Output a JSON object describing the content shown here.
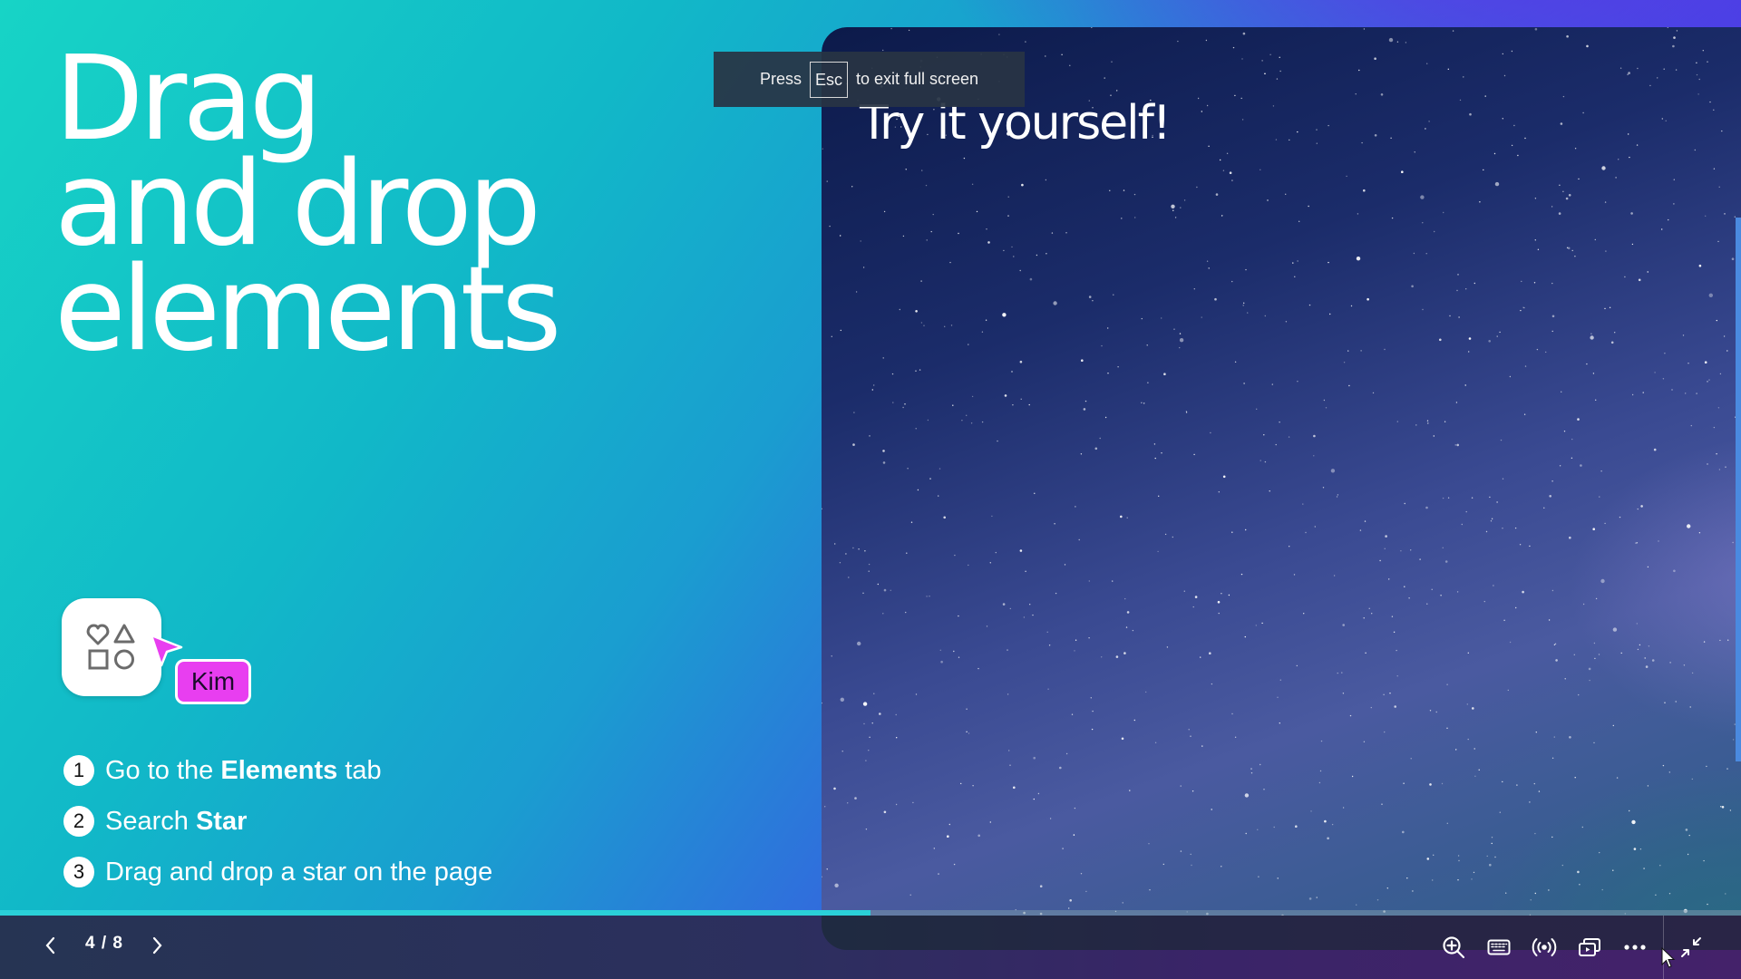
{
  "slide": {
    "title_lines": [
      "Drag",
      "and drop",
      "elements"
    ],
    "photo_title": "Try it yourself!",
    "collaborator_label": "Kim",
    "steps": [
      {
        "number": "1",
        "text_before": "Go to the ",
        "bold": "Elements",
        "text_after": " tab"
      },
      {
        "number": "2",
        "text_before": "Search ",
        "bold": "Star",
        "text_after": ""
      },
      {
        "number": "3",
        "text_before": "Drag and drop a star on the page",
        "bold": "",
        "text_after": ""
      }
    ],
    "icons": {
      "elements_tile": "shapes-icon",
      "collaborator_cursor": "pointer-cursor-icon"
    }
  },
  "toast": {
    "prefix": "Press",
    "key": "Esc",
    "suffix": "to exit full screen"
  },
  "presenter": {
    "page_current": 4,
    "page_total": 8,
    "page_label": "4 / 8",
    "progress_fraction": 0.5,
    "prev_icon": "chevron-left-icon",
    "next_icon": "chevron-right-icon",
    "controls": [
      {
        "name": "zoom-in",
        "icon": "zoom-in-icon"
      },
      {
        "name": "keyboard-shortcuts",
        "icon": "keyboard-icon"
      },
      {
        "name": "live-broadcast",
        "icon": "broadcast-icon"
      },
      {
        "name": "presenter-view",
        "icon": "presenter-view-icon"
      },
      {
        "name": "more-options",
        "icon": "more-horizontal-icon"
      },
      {
        "name": "exit-fullscreen",
        "icon": "minimize-icon"
      }
    ]
  },
  "colors": {
    "progress_fill": "#2ad0d8",
    "collaborator": "#e83ef0",
    "bottom_bar": "#263453"
  }
}
